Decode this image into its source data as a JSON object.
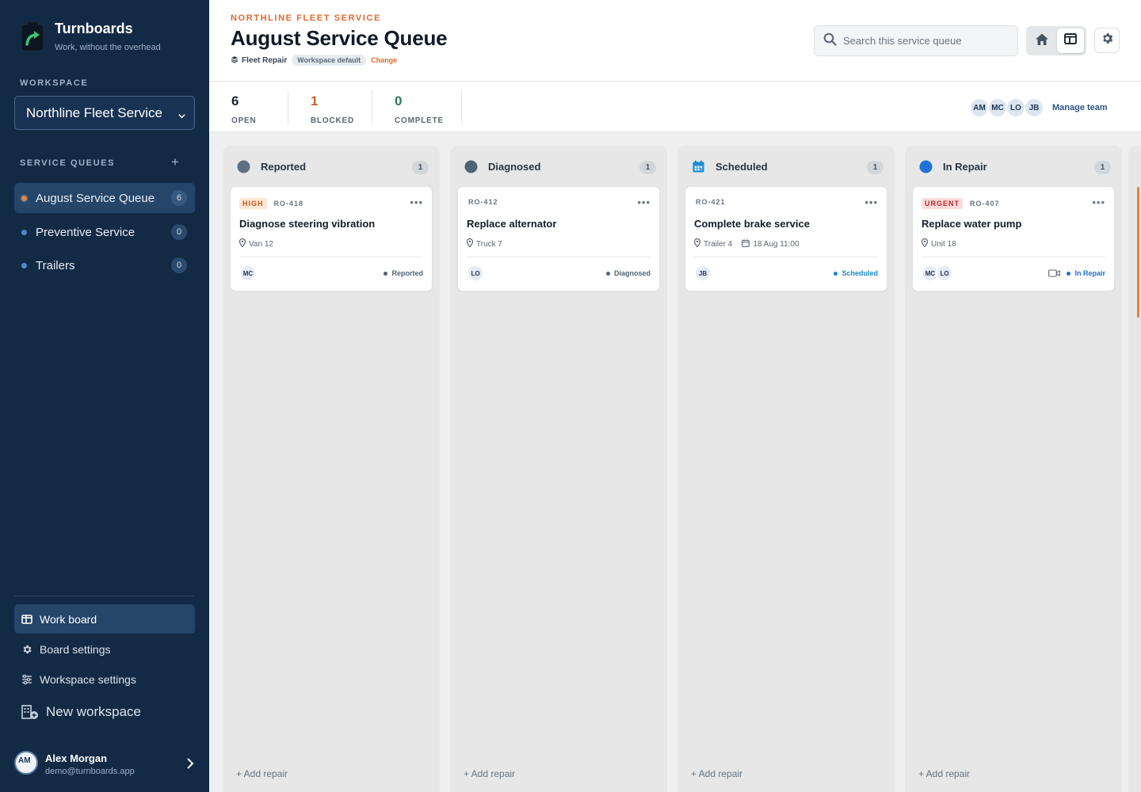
{
  "app": {
    "name": "Turnboards",
    "tagline": "Work, without the overhead"
  },
  "sidebar": {
    "workspace_label": "WORKSPACE",
    "workspace_value": "Northline Fleet Service",
    "queues_label": "SERVICE QUEUES",
    "add_queue": "+",
    "queues": [
      {
        "label": "August Service Queue",
        "count": "6"
      },
      {
        "label": "Preventive Service",
        "count": "0"
      },
      {
        "label": "Trailers",
        "count": "0"
      }
    ],
    "nav": [
      {
        "label": "Work board"
      },
      {
        "label": "Board settings"
      },
      {
        "label": "Workspace settings"
      },
      {
        "label": "New workspace"
      }
    ],
    "user": {
      "initials": "AM",
      "name": "Alex Morgan",
      "email": "demo@turnboards.app"
    }
  },
  "header": {
    "eyebrow": "NORTHLINE FLEET SERVICE",
    "title": "August Service Queue",
    "board_type": "Fleet Repair",
    "default_pill": "Workspace default",
    "change": "Change",
    "search_placeholder": "Search this service queue"
  },
  "stats": [
    {
      "value": "6",
      "label": "OPEN",
      "color": "#1b2633"
    },
    {
      "value": "1",
      "label": "BLOCKED",
      "color": "#c8632b"
    },
    {
      "value": "0",
      "label": "COMPLETE",
      "color": "#2f7a58"
    }
  ],
  "team": {
    "members": [
      "AM",
      "MC",
      "LO",
      "JB"
    ],
    "manage_label": "Manage team"
  },
  "columns": [
    {
      "title": "Reported",
      "count": "1",
      "icon": "circle-gray-icon",
      "card": {
        "priority": "HIGH",
        "ro": "RO-418",
        "title": "Diagnose steering vibration",
        "location": "Van 12",
        "date": "",
        "assignees": [
          "MC"
        ],
        "status": "Reported",
        "status_color": "#4e6576"
      },
      "add_label": "+ Add repair"
    },
    {
      "title": "Diagnosed",
      "count": "1",
      "icon": "circle-slate-icon",
      "card": {
        "priority": "",
        "ro": "RO-412",
        "title": "Replace alternator",
        "location": "Truck 7",
        "date": "",
        "assignees": [
          "LO"
        ],
        "status": "Diagnosed",
        "status_color": "#4e6576"
      },
      "add_label": "+ Add repair"
    },
    {
      "title": "Scheduled",
      "count": "1",
      "icon": "calendar-icon",
      "card": {
        "priority": "",
        "ro": "RO-421",
        "title": "Complete brake service",
        "location": "Trailer 4",
        "date": "18 Aug 11:00",
        "assignees": [
          "JB"
        ],
        "status": "Scheduled",
        "status_color": "#1a88c9"
      },
      "add_label": "+ Add repair"
    },
    {
      "title": "In Repair",
      "count": "1",
      "icon": "circle-blue-icon",
      "card": {
        "priority": "URGENT",
        "ro": "RO-407",
        "title": "Replace water pump",
        "location": "Unit 18",
        "date": "",
        "assignees": [
          "MC",
          "LO"
        ],
        "status": "In Repair",
        "status_color": "#1f6fd0"
      },
      "add_label": "+ Add repair"
    }
  ]
}
